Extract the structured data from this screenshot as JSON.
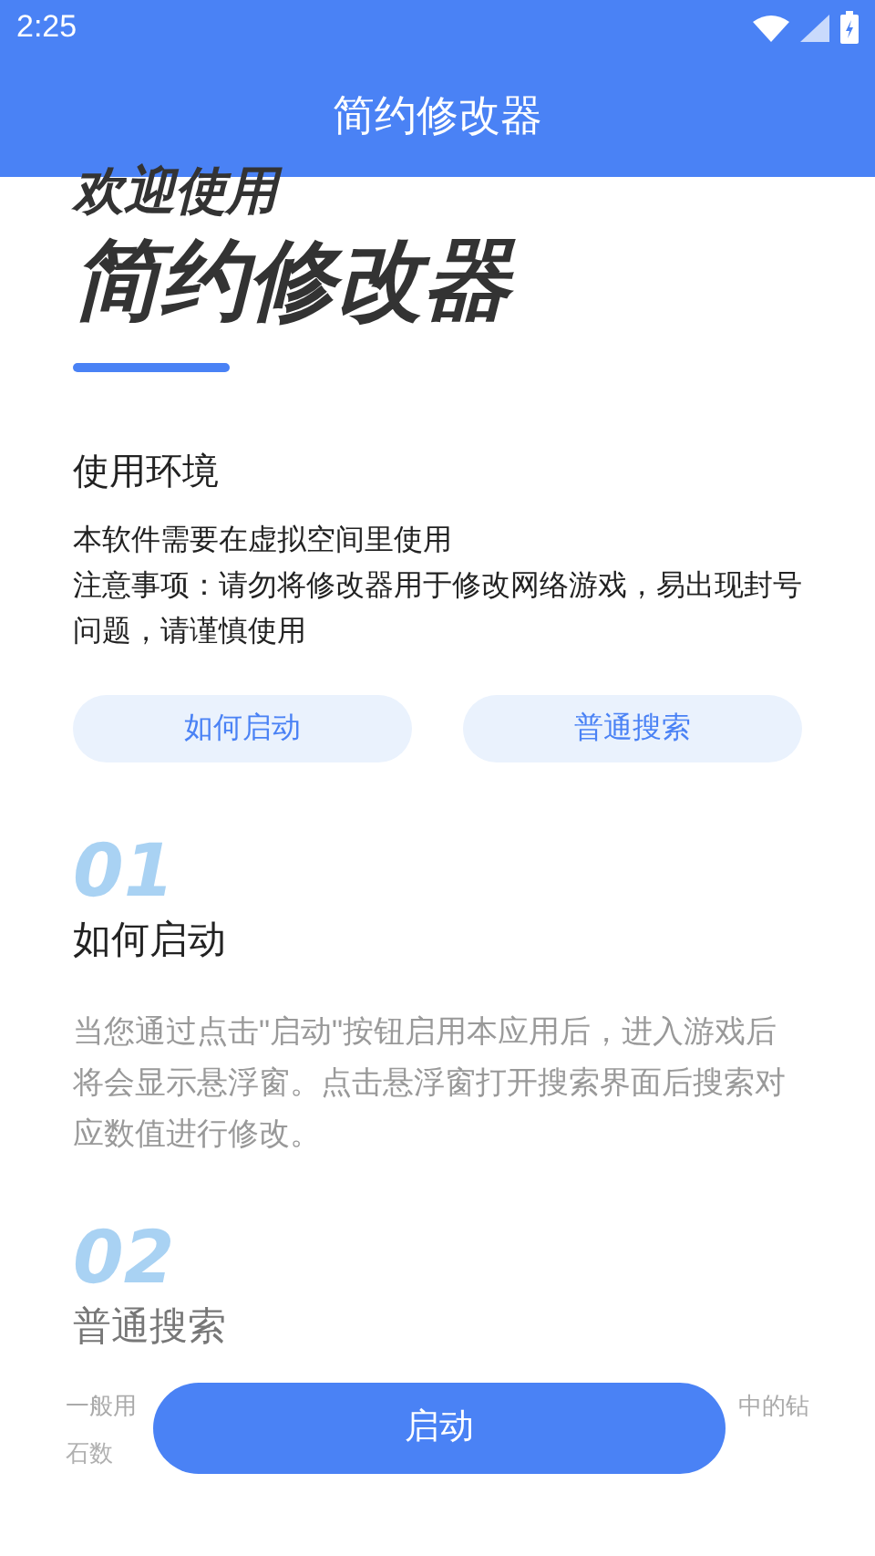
{
  "status_bar": {
    "time": "2:25"
  },
  "app_bar": {
    "title": "简约修改器"
  },
  "hero": {
    "subtitle": "欢迎使用",
    "title": "简约修改器"
  },
  "environment": {
    "heading": "使用环境",
    "lines": [
      "本软件需要在虚拟空间里使用",
      "注意事项：请勿将修改器用于修改网络游戏，易出现封号问题，请谨慎使用"
    ]
  },
  "quick_buttons": [
    "如何启动",
    "普通搜索"
  ],
  "sections": [
    {
      "number": "01",
      "heading": "如何启动",
      "description_parts": [
        "当您通过点击\"启动\"按钮启用本应用后，进入游戏后将会显示悬浮窗。点击悬浮窗打开搜索界面后搜索对应数值进行修改。"
      ]
    },
    {
      "number": "02",
      "heading": "普通搜索",
      "description_parts": [
        "一般用",
        "中的钻",
        "石数"
      ]
    }
  ],
  "primary_button": "启动"
}
